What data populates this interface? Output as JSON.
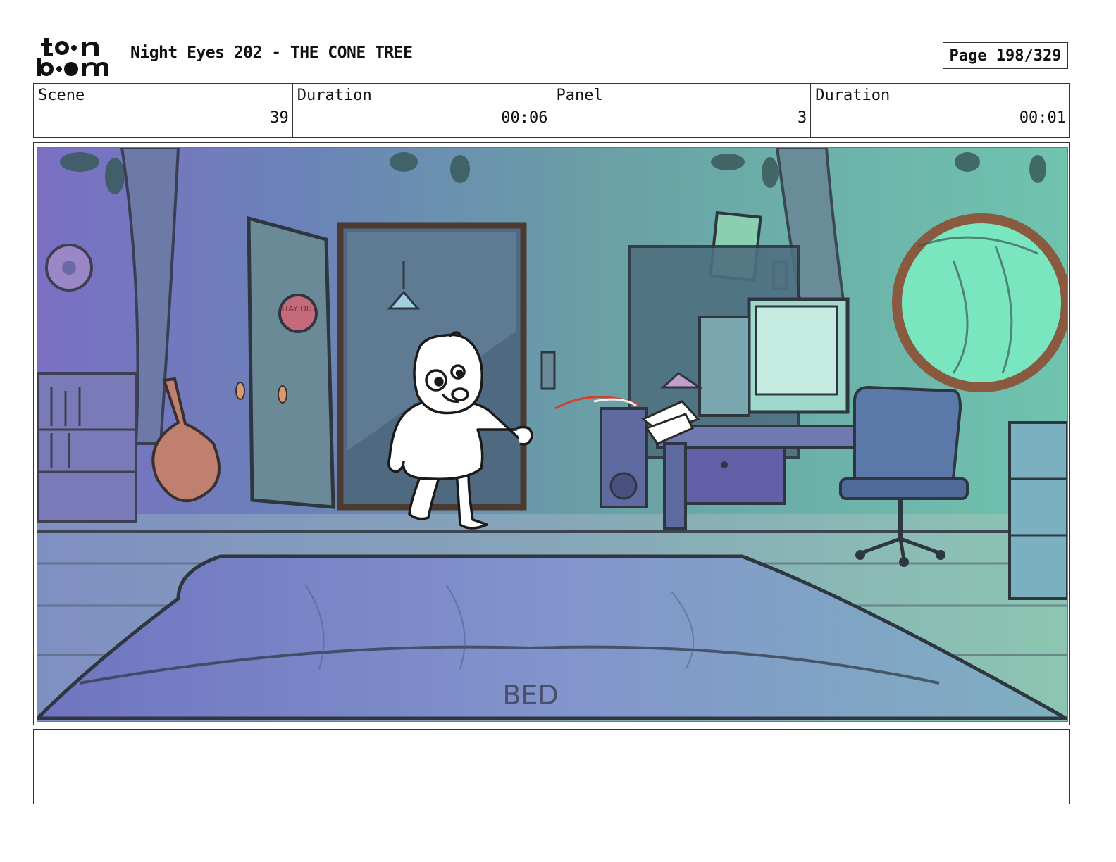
{
  "header": {
    "logo_alt": "toon boom",
    "title": "Night Eyes 202 - THE CONE TREE",
    "page": "Page 198/329"
  },
  "info": {
    "scene_label": "Scene",
    "scene_value": "39",
    "scene_duration_label": "Duration",
    "scene_duration_value": "00:06",
    "panel_label": "Panel",
    "panel_value": "3",
    "panel_duration_label": "Duration",
    "panel_duration_value": "00:01"
  },
  "panel": {
    "bed_label": "BED",
    "door_sign": "STAY OUT"
  },
  "notes": {
    "text": ""
  }
}
